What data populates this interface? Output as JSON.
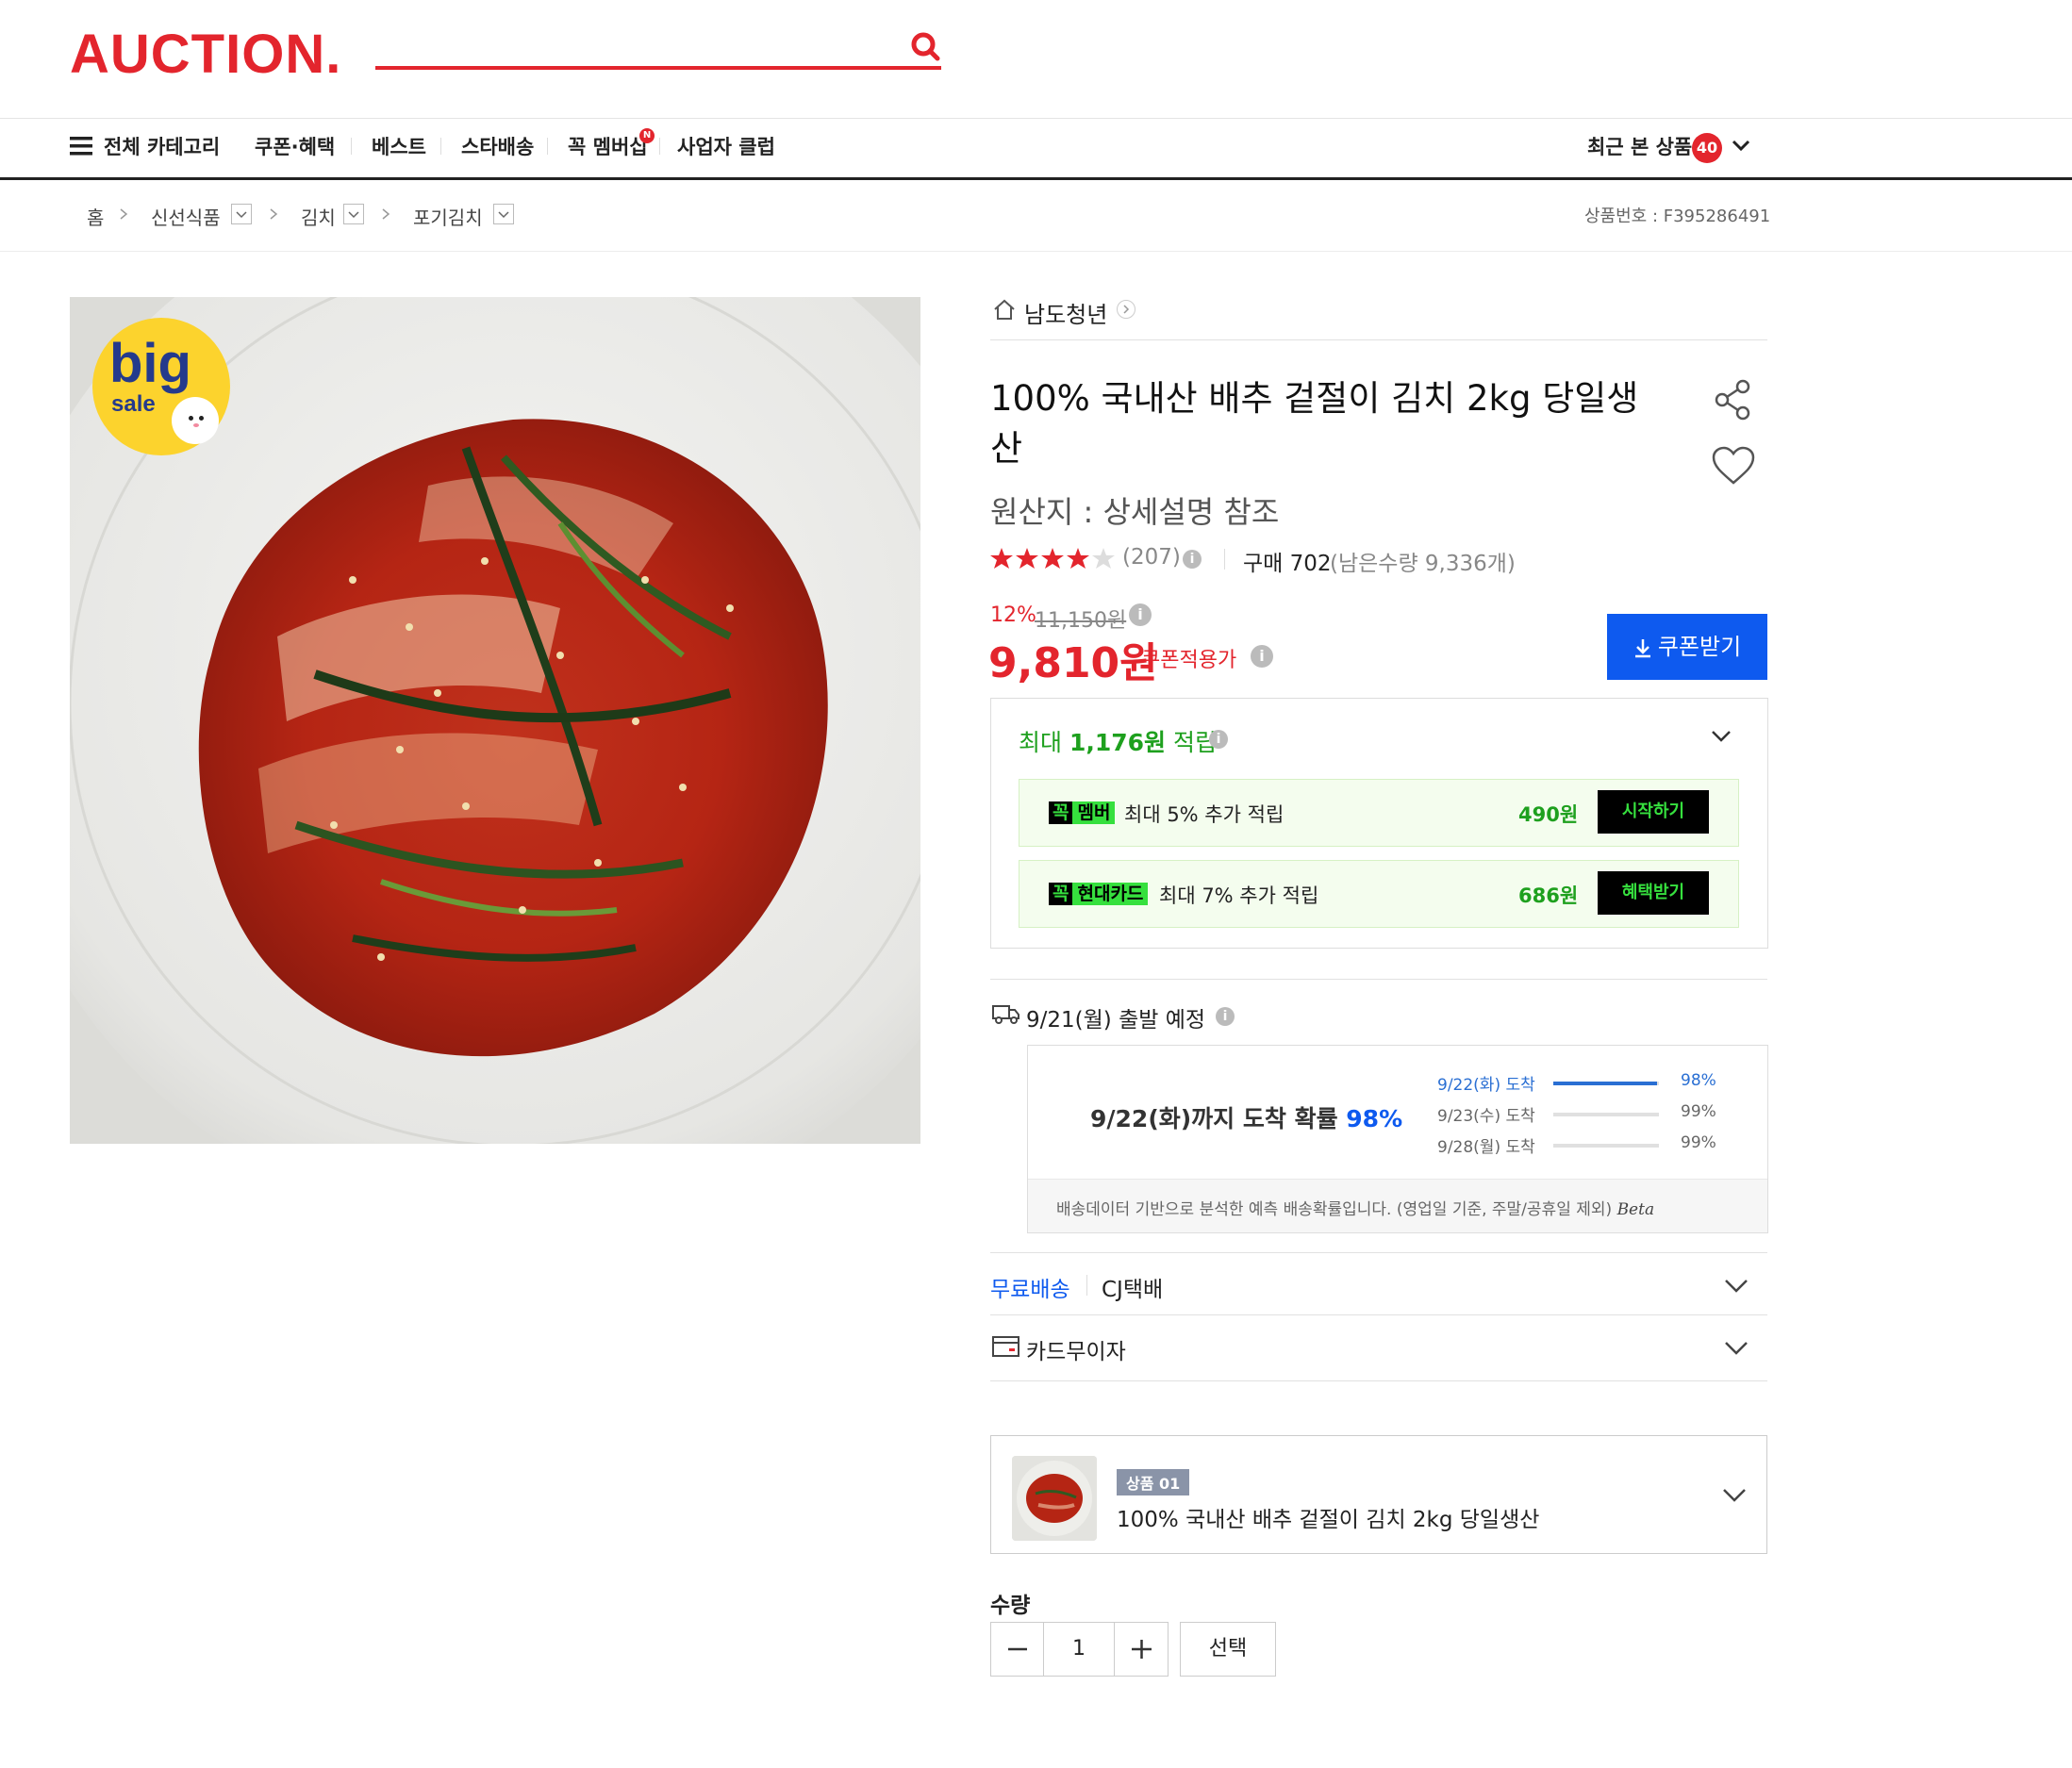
{
  "header": {
    "logo": "AUCTION.",
    "nav": [
      "전체 카테고리",
      "쿠폰·혜택",
      "베스트",
      "스타배송",
      "꼭 멤버십",
      "사업자 클럽"
    ],
    "nav_badge": "N",
    "recent_label": "최근 본 상품",
    "recent_count": "40"
  },
  "breadcrumb": {
    "items": [
      "홈",
      "신선식품",
      "김치",
      "포기김치"
    ],
    "product_code": "상품번호 : F395286491"
  },
  "image": {
    "badge_big": "big",
    "badge_sale": "sale"
  },
  "product": {
    "store": "남도청년",
    "title": "100% 국내산 배추 겉절이 김치 2kg 당일생산",
    "origin": "원산지 : 상세설명 참조",
    "rating": 4.5,
    "review_count": "(207)",
    "purchase_label": "구매 702",
    "stock": "(남은수량 9,336개)",
    "discount_rate": "12%",
    "original_price": "11,150원",
    "price": "9,810원",
    "price_note": "쿠폰적용가",
    "coupon_button": "쿠폰받기"
  },
  "points": {
    "label_prefix": "최대 ",
    "amount": "1,176원",
    "label_suffix": " 적립",
    "rows": [
      {
        "tag_black": "꼭",
        "tag_green": "멤버",
        "text": "최대 5% 추가 적립",
        "value": "490원",
        "button": "시작하기"
      },
      {
        "tag_black": "꼭",
        "tag_green": "현대카드",
        "text": "최대 7% 추가 적립",
        "value": "686원",
        "button": "혜택받기"
      }
    ]
  },
  "shipping": {
    "departure": "9/21(월) 출발 예정",
    "arrival_main": "9/22(화)까지 도착 확률 ",
    "arrival_pct": "98%",
    "rows": [
      {
        "label": "9/22(화) 도착",
        "pct": "98%",
        "value": 0.98,
        "highlight": true
      },
      {
        "label": "9/23(수) 도착",
        "pct": "99%",
        "value": 0.99,
        "highlight": false
      },
      {
        "label": "9/28(월) 도착",
        "pct": "99%",
        "value": 0.99,
        "highlight": false
      }
    ],
    "note": "배송데이터 기반으로 분석한 예측 배송확률입니다. (영업일 기준, 주말/공휴일 제외)",
    "beta": "Beta",
    "free_label": "무료배송",
    "carrier": "CJ택배",
    "installment": "카드무이자"
  },
  "option": {
    "tag": "상품 01",
    "name": "100% 국내산 배추 겉절이 김치 2kg 당일생산"
  },
  "quantity": {
    "label": "수량",
    "value": "1",
    "select": "선택"
  },
  "colors": {
    "brand_red": "#e3252d",
    "blue": "#0e5aef",
    "green": "#1ea01e",
    "neon": "#36e03e"
  }
}
